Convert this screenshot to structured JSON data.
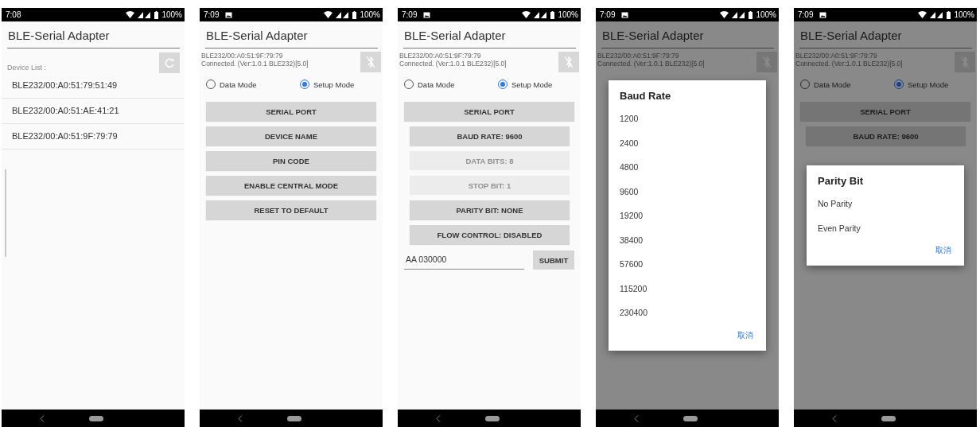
{
  "screens": [
    {
      "status_bar": {
        "time": "7:08",
        "notification_icon": false,
        "battery": "100%"
      },
      "app_bar": {
        "title": "BLE-Serial Adapter"
      },
      "list_label": "Device List :",
      "devices": [
        "BLE232/00:A0:51:79:51:49",
        "BLE232/00:A0:51:AE:41:21",
        "BLE232/00:A0:51:9F:79:79"
      ]
    },
    {
      "status_bar": {
        "time": "7:09",
        "notification_icon": true,
        "battery": "100%"
      },
      "app_bar": {
        "title": "BLE-Serial Adapter"
      },
      "connection": {
        "device": "BLE232/00:A0:51:9F:79:79",
        "status": "Connected. (Ver:1.0.1 BLE232)[5.0]"
      },
      "modes": [
        {
          "label": "Data Mode",
          "selected": false
        },
        {
          "label": "Setup Mode",
          "selected": true
        }
      ],
      "buttons": [
        {
          "label": "SERIAL PORT"
        },
        {
          "label": "DEVICE NAME"
        },
        {
          "label": "PIN CODE"
        },
        {
          "label": "ENABLE CENTRAL MODE"
        },
        {
          "label": "RESET TO DEFAULT"
        }
      ]
    },
    {
      "status_bar": {
        "time": "7:09",
        "notification_icon": true,
        "battery": "100%"
      },
      "app_bar": {
        "title": "BLE-Serial Adapter"
      },
      "connection": {
        "device": "BLE232/00:A0:51:9F:79:79",
        "status": "Connected. (Ver:1.0.1 BLE232)[5.0]"
      },
      "modes": [
        {
          "label": "Data Mode",
          "selected": false
        },
        {
          "label": "Setup Mode",
          "selected": true
        }
      ],
      "buttons": [
        {
          "label": "SERIAL PORT",
          "children": [
            {
              "label": "BAUD RATE: 9600",
              "disabled": false
            },
            {
              "label": "DATA BITS: 8",
              "disabled": true
            },
            {
              "label": "STOP BIT: 1",
              "disabled": true
            },
            {
              "label": "PARITY BIT: NONE",
              "disabled": false
            },
            {
              "label": "FLOW CONTROL: DISABLED",
              "disabled": false
            }
          ]
        }
      ],
      "command": {
        "value": "AA 030000",
        "submit": "SUBMIT"
      }
    },
    {
      "status_bar": {
        "time": "7:09",
        "notification_icon": true,
        "battery": "100%"
      },
      "app_bar": {
        "title": "BLE-Serial Adapter"
      },
      "connection": {
        "device": "BLE232/00:A0:51:9F:79:79",
        "status": "Connected. (Ver:1.0.1 BLE232)[5.0]"
      },
      "dialog": {
        "title": "Baud Rate",
        "options": [
          "1200",
          "2400",
          "4800",
          "9600",
          "19200",
          "38400",
          "57600",
          "115200",
          "230400"
        ],
        "cancel": "取消"
      }
    },
    {
      "status_bar": {
        "time": "7:09",
        "notification_icon": true,
        "battery": "100%"
      },
      "app_bar": {
        "title": "BLE-Serial Adapter"
      },
      "connection": {
        "device": "BLE232/00:A0:51:9F:79:79",
        "status": "Connected. (Ver:1.0.1 BLE232)[5.0]"
      },
      "modes": [
        {
          "label": "Data Mode",
          "selected": false
        },
        {
          "label": "Setup Mode",
          "selected": true
        }
      ],
      "buttons": [
        {
          "label": "SERIAL PORT",
          "children": [
            {
              "label": "BAUD RATE: 9600",
              "disabled": false
            }
          ]
        }
      ],
      "dialog": {
        "title": "Parity Bit",
        "options": [
          "No Parity",
          "Even Parity"
        ],
        "cancel": "取消"
      }
    }
  ]
}
